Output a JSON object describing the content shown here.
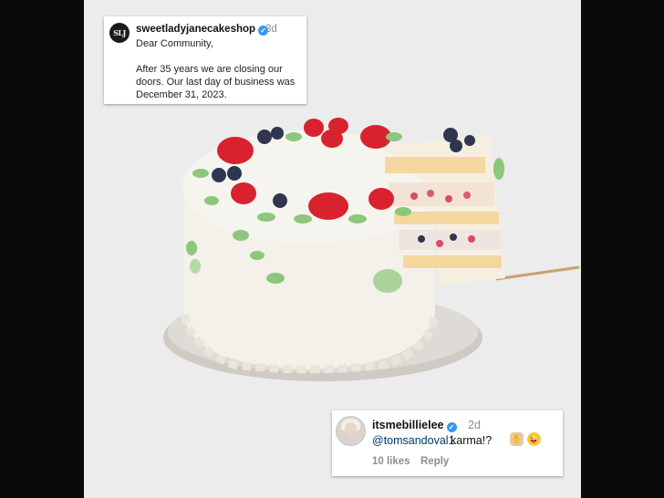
{
  "post": {
    "avatar_text": "SLJ",
    "username": "sweetladyjanecakeshop",
    "verified_mark": "✓",
    "time": "3d",
    "lines": [
      "Dear Community,",
      "",
      "After 35 years we are closing our",
      "doors. Our last day of business was",
      "December 31, 2023."
    ]
  },
  "comment": {
    "username": "itsmebillielee",
    "verified_mark": "✓",
    "time": "2d",
    "mention": "@tomsandoval1",
    "text": "karma!?",
    "emojis": [
      "clap-hand-emoji",
      "winking-tongue-face-emoji"
    ],
    "likes": "10 likes",
    "reply_label": "Reply"
  },
  "photo": {
    "subject": "cake-photo",
    "colors": {
      "background": "#ececec",
      "frosting": "#f3f1ea",
      "strawberry": "#d8232e",
      "blueberry": "#2f3650",
      "leaf": "#8cc77b"
    }
  }
}
